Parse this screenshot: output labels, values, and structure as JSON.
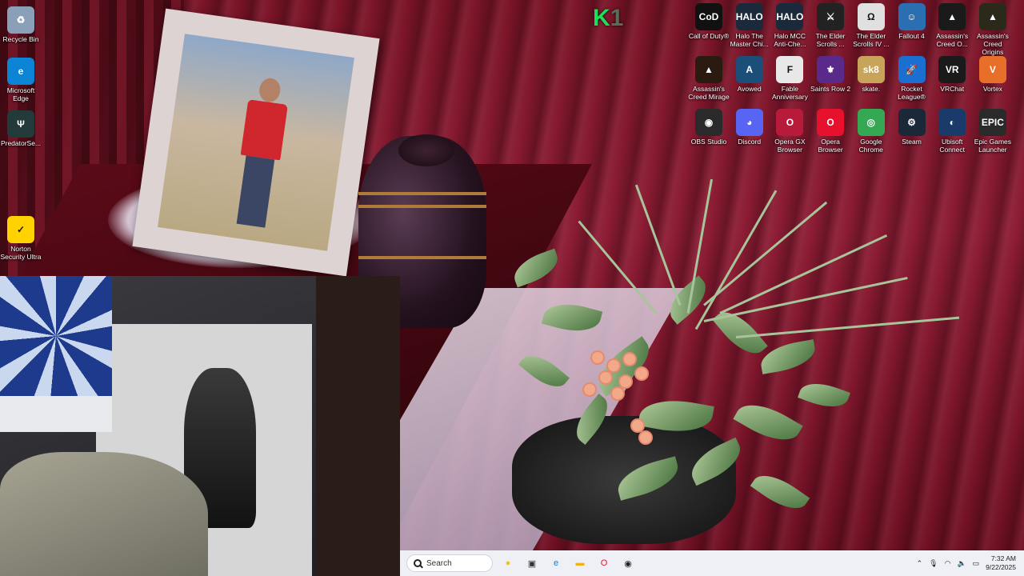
{
  "desktop_icons_left": [
    {
      "label": "Recycle Bin",
      "icon": "recycle-bin-icon",
      "color": "#8aa0b8",
      "glyph": "♻"
    },
    {
      "label": "Microsoft Edge",
      "icon": "edge-icon",
      "color": "#0b84d6",
      "glyph": "e"
    },
    {
      "label": "PredatorSe...",
      "icon": "predator-sense-icon",
      "color": "#223a3a",
      "glyph": "Ψ"
    },
    {
      "label": "Norton Security Ultra",
      "icon": "norton-icon",
      "color": "#ffd200",
      "glyph": "✓"
    }
  ],
  "desktop_icons_right": [
    {
      "label": "Call of Duty®",
      "icon": "call-of-duty-icon",
      "color": "#111111",
      "glyph": "CoD"
    },
    {
      "label": "Halo The Master Chi...",
      "icon": "halo-mcc-icon",
      "color": "#1a2a3a",
      "glyph": "HALO"
    },
    {
      "label": "Halo MCC Anti-Che...",
      "icon": "halo-anticheat-icon",
      "color": "#1a2a3a",
      "glyph": "HALO"
    },
    {
      "label": "The Elder Scrolls ...",
      "icon": "elder-scrolls-icon",
      "color": "#222222",
      "glyph": "⚔"
    },
    {
      "label": "The Elder Scrolls IV ...",
      "icon": "oblivion-icon",
      "color": "#e0e0e0",
      "glyph": "Ω"
    },
    {
      "label": "Fallout 4",
      "icon": "fallout-icon",
      "color": "#2b6fb3",
      "glyph": "☺"
    },
    {
      "label": "Assassin's Creed O...",
      "icon": "assassins-creed-odyssey-icon",
      "color": "#1a1a1a",
      "glyph": "▲"
    },
    {
      "label": "Assassin's Creed Origins",
      "icon": "assassins-creed-origins-icon",
      "color": "#2b2a1a",
      "glyph": "▲"
    },
    {
      "label": "Assassin's Creed Mirage",
      "icon": "assassins-creed-mirage-icon",
      "color": "#2a1a10",
      "glyph": "▲"
    },
    {
      "label": "Avowed",
      "icon": "avowed-icon",
      "color": "#1b4f7a",
      "glyph": "A"
    },
    {
      "label": "Fable Anniversary",
      "icon": "fable-icon",
      "color": "#e8e8e8",
      "glyph": "F"
    },
    {
      "label": "Saints Row 2",
      "icon": "saints-row-icon",
      "color": "#5a2a8a",
      "glyph": "⚜"
    },
    {
      "label": "skate.",
      "icon": "skate-icon",
      "color": "#c8a35a",
      "glyph": "sk8"
    },
    {
      "label": "Rocket League®",
      "icon": "rocket-league-icon",
      "color": "#1a6fd0",
      "glyph": "🚀"
    },
    {
      "label": "VRChat",
      "icon": "vrchat-icon",
      "color": "#1a1a1a",
      "glyph": "VR"
    },
    {
      "label": "Vortex",
      "icon": "vortex-icon",
      "color": "#e86f2a",
      "glyph": "V"
    },
    {
      "label": "OBS Studio",
      "icon": "obs-icon",
      "color": "#2a2a2a",
      "glyph": "◉"
    },
    {
      "label": "Discord",
      "icon": "discord-icon",
      "color": "#5865f2",
      "glyph": "◕"
    },
    {
      "label": "Opera GX Browser",
      "icon": "opera-gx-icon",
      "color": "#b81a3a",
      "glyph": "O"
    },
    {
      "label": "Opera Browser",
      "icon": "opera-icon",
      "color": "#e8112d",
      "glyph": "O"
    },
    {
      "label": "Google Chrome",
      "icon": "chrome-icon",
      "color": "#34a853",
      "glyph": "◎"
    },
    {
      "label": "Steam",
      "icon": "steam-icon",
      "color": "#1b2838",
      "glyph": "⚙"
    },
    {
      "label": "Ubisoft Connect",
      "icon": "ubisoft-icon",
      "color": "#1a3a6a",
      "glyph": "◐"
    },
    {
      "label": "Epic Games Launcher",
      "icon": "epic-games-icon",
      "color": "#2a2a2a",
      "glyph": "EPIC"
    }
  ],
  "overlay_logo": {
    "primary": "K",
    "secondary": "1"
  },
  "taskbar": {
    "search_placeholder": "Search",
    "apps": [
      {
        "icon": "widgets-icon",
        "color": "#f2c018",
        "glyph": "●"
      },
      {
        "icon": "task-view-icon",
        "color": "#333333",
        "glyph": "▣"
      },
      {
        "icon": "edge-taskbar-icon",
        "color": "#0b84d6",
        "glyph": "e"
      },
      {
        "icon": "file-explorer-icon",
        "color": "#f2b01a",
        "glyph": "▬"
      },
      {
        "icon": "opera-taskbar-icon",
        "color": "#e8112d",
        "glyph": "O"
      },
      {
        "icon": "obs-taskbar-icon",
        "color": "#222222",
        "glyph": "◉"
      }
    ],
    "clock_time": "7:32 AM",
    "clock_date": "9/22/2025"
  }
}
